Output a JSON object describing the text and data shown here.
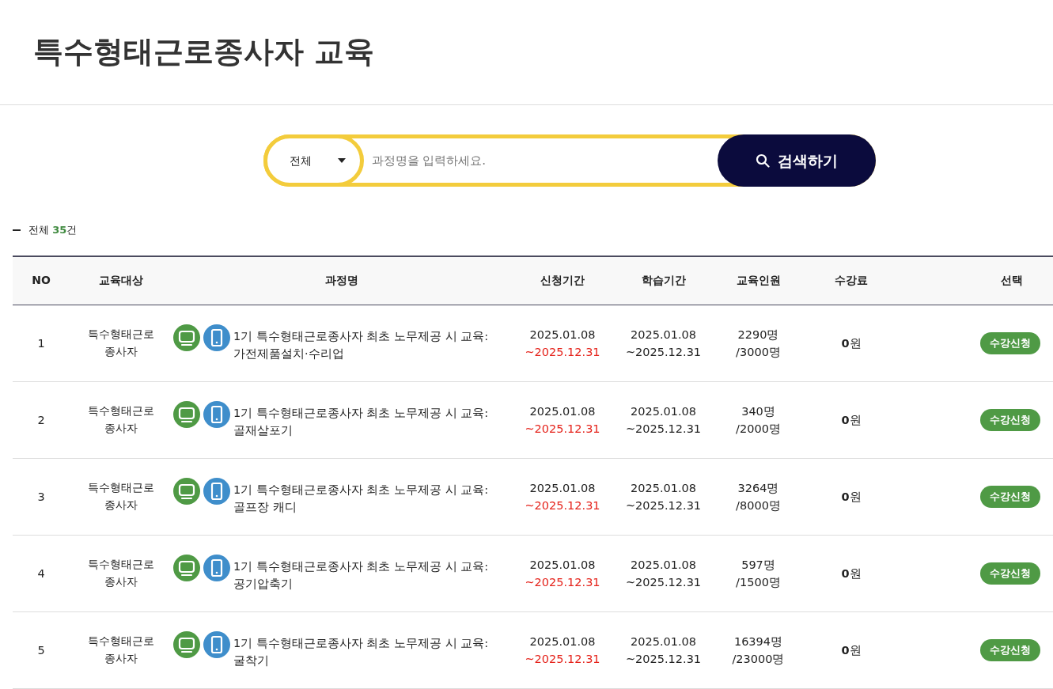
{
  "page_title": "특수형태근로종사자 교육",
  "search": {
    "category": "전체",
    "placeholder": "과정명을 입력하세요.",
    "button": "검색하기"
  },
  "summary": {
    "label": "전체",
    "count": "35",
    "unit": "건"
  },
  "table": {
    "columns": [
      "NO",
      "교육대상",
      "과정명",
      "신청기간",
      "학습기간",
      "교육인원",
      "수강료",
      "선택"
    ],
    "rows": [
      {
        "no": "1",
        "target": "특수형태근로종사자",
        "title": "1기 특수형태근로종사자 최초 노무제공 시 교육: 가전제품설치·수리업",
        "apply": [
          "2025.01.08",
          "~2025.12.31"
        ],
        "study": [
          "2025.01.08",
          "~2025.12.31"
        ],
        "people": [
          "2290명",
          "/3000명"
        ],
        "fee": "**0**원",
        "action": "수강신청"
      },
      {
        "no": "2",
        "target": "특수형태근로종사자",
        "title": "1기 특수형태근로종사자 최초 노무제공 시 교육: 골재살포기",
        "apply": [
          "2025.01.08",
          "~2025.12.31"
        ],
        "study": [
          "2025.01.08",
          "~2025.12.31"
        ],
        "people": [
          "340명",
          "/2000명"
        ],
        "fee": "**0**원",
        "action": "수강신청"
      },
      {
        "no": "3",
        "target": "특수형태근로종사자",
        "title": "1기 특수형태근로종사자 최초 노무제공 시 교육: 골프장 캐디",
        "apply": [
          "2025.01.08",
          "~2025.12.31"
        ],
        "study": [
          "2025.01.08",
          "~2025.12.31"
        ],
        "people": [
          "3264명",
          "/8000명"
        ],
        "fee": "**0**원",
        "action": "수강신청"
      },
      {
        "no": "4",
        "target": "특수형태근로종사자",
        "title": "1기 특수형태근로종사자 최초 노무제공 시 교육: 공기압축기",
        "apply": [
          "2025.01.08",
          "~2025.12.31"
        ],
        "study": [
          "2025.01.08",
          "~2025.12.31"
        ],
        "people": [
          "597명",
          "/1500명"
        ],
        "fee": "**0**원",
        "action": "수강신청"
      },
      {
        "no": "5",
        "target": "특수형태근로종사자",
        "title": "1기 특수형태근로종사자 최초 노무제공 시 교육: 굴착기",
        "apply": [
          "2025.01.08",
          "~2025.12.31"
        ],
        "study": [
          "2025.01.08",
          "~2025.12.31"
        ],
        "people": [
          "16394명",
          "/23000명"
        ],
        "fee": "**0**원",
        "action": "수강신청"
      }
    ]
  }
}
